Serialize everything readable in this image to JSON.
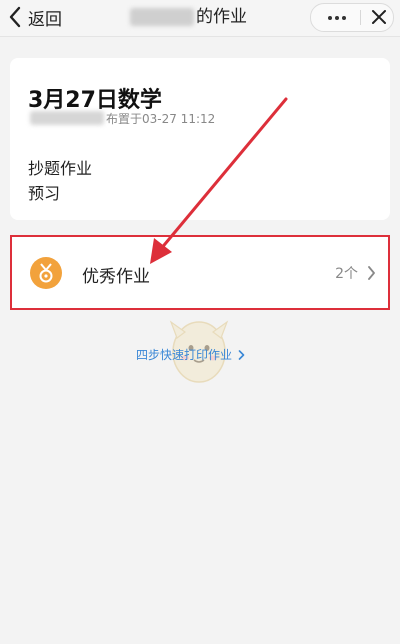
{
  "nav": {
    "back_label": "返回",
    "title_suffix": "的作业"
  },
  "homework": {
    "title": "3月27日数学",
    "assigned_text": "布置于03-27 11:12",
    "tasks": [
      "抄题作业",
      "预习"
    ]
  },
  "excellent": {
    "label": "优秀作业",
    "count": "2个"
  },
  "print_link": "四步快速打印作业",
  "colors": {
    "annotation_red": "#dd2f3a",
    "medal_orange": "#f2a23c",
    "link_blue": "#3a87d6"
  },
  "icons": [
    "chevron-left-icon",
    "more-icon",
    "close-icon",
    "medal-icon",
    "chevron-right-icon"
  ]
}
